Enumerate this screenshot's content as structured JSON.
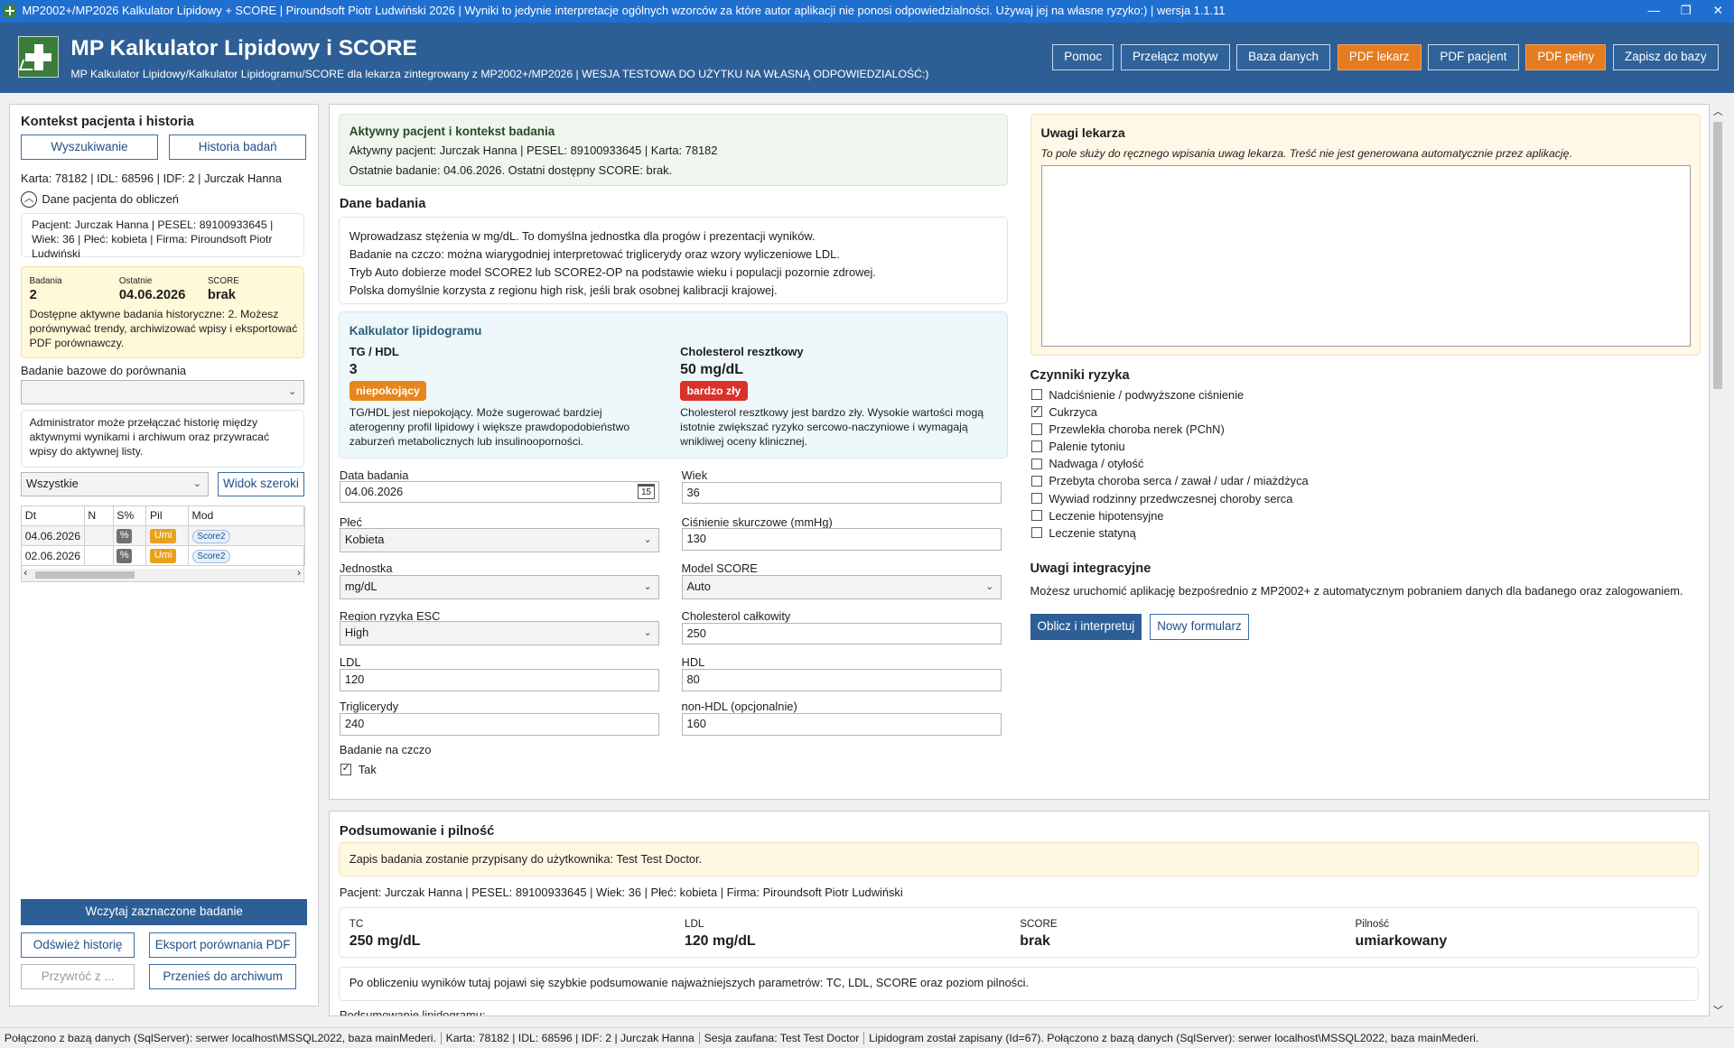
{
  "window": {
    "title": "MP2002+/MP2026 Kalkulator Lipidowy + SCORE | Piroundsoft Piotr Ludwiński 2026 | Wyniki to jedynie interpretacje ogólnych wzorców za które autor aplikacji nie ponosi odpowiedzialności. Używaj jej na własne ryzyko:) | wersja 1.1.11",
    "minimize": "—",
    "restore": "❐",
    "close": "✕"
  },
  "header": {
    "title": "MP Kalkulator Lipidowy i SCORE",
    "subtitle": "MP Kalkulator Lipidowy/Kalkulator Lipidogramu/SCORE dla lekarza zintegrowany z MP2002+/MP2026 | WESJA TESTOWA DO UŻYTKU NA WŁASNĄ ODPOWIEDZIALOŚĆ:)",
    "buttons": [
      "Pomoc",
      "Przełącz motyw",
      "Baza danych",
      "PDF lekarz",
      "PDF pacjent",
      "PDF pełny",
      "Zapisz do bazy"
    ]
  },
  "left": {
    "title": "Kontekst pacjenta i historia",
    "search_btn": "Wyszukiwanie",
    "history_btn": "Historia badań",
    "card_line": "Karta: 78182 | IDL: 68596 | IDF: 2 | Jurczak Hanna",
    "collapse_label": "Dane pacjenta do obliczeń",
    "patient_info": "Pacjent: Jurczak Hanna | PESEL: 89100933645 | Wiek: 36 | Płeć: kobieta | Firma: Piroundsoft  Piotr Ludwiński",
    "stats": {
      "badania_lbl": "Badania",
      "badania_val": "2",
      "ostatnie_lbl": "Ostatnie",
      "ostatnie_val": "04.06.2026",
      "score_lbl": "SCORE",
      "score_val": "brak",
      "desc": "Dostępne aktywne badania historyczne: 2. Możesz porównywać trendy, archiwizować wpisy i eksportować PDF porównawczy."
    },
    "baseline_label": "Badanie bazowe do porównania",
    "baseline_value": "",
    "admin_note": "Administrator może przełączać historię między aktywnymi wynikami i archiwum oraz przywracać wpisy do aktywnej listy.",
    "filter_value": "Wszystkie",
    "wide_view_btn": "Widok szeroki",
    "table": {
      "headers": [
        "Dt",
        "N",
        "S%",
        "Pil",
        "Mod"
      ],
      "rows": [
        {
          "dt": "04.06.2026",
          "n": "",
          "s": "%",
          "pil": "Umi",
          "mod": "Score2"
        },
        {
          "dt": "02.06.2026",
          "n": "",
          "s": "%",
          "pil": "Umi",
          "mod": "Score2"
        }
      ]
    },
    "load_btn": "Wczytaj zaznaczone badanie",
    "refresh_btn": "Odśwież historię",
    "export_btn": "Eksport porównania PDF",
    "restore_btn": "Przywróć z ...",
    "archive_btn": "Przenieś do archiwum"
  },
  "context": {
    "title": "Aktywny pacjent i kontekst badania",
    "line1": "Aktywny pacjent: Jurczak Hanna | PESEL: 89100933645 | Karta: 78182",
    "line2": "Ostatnie badanie: 04.06.2026. Ostatni dostępny SCORE: brak."
  },
  "dane": {
    "title": "Dane badania",
    "lines": [
      "Wprowadzasz stężenia w mg/dL. To domyślna jednostka dla progów i prezentacji wyników.",
      "Badanie na czczo: można wiarygodniej interpretować triglicerydy oraz wzory wyliczeniowe LDL.",
      "Tryb Auto dobierze model SCORE2 lub SCORE2-OP na podstawie wieku i populacji pozornie zdrowej.",
      "Polska domyślnie korzysta z regionu high risk, jeśli brak osobnej kalibracji krajowej."
    ]
  },
  "calc": {
    "title": "Kalkulator lipidogramu",
    "tg_label": "TG / HDL",
    "tg_value": "3",
    "tg_badge": "niepokojący",
    "tg_desc": "TG/HDL jest niepokojący. Może sugerować bardziej aterogenny profil lipidowy i większe prawdopodobieństwo zaburzeń metabolicznych lub insulinooporności.",
    "rc_label": "Cholesterol resztkowy",
    "rc_value": "50 mg/dL",
    "rc_badge": "bardzo zły",
    "rc_desc": "Cholesterol resztkowy jest bardzo zły. Wysokie wartości mogą istotnie zwiększać ryzyko sercowo-naczyniowe i wymagają wnikliwej oceny klinicznej.",
    "colors": {
      "warn": "#e8861e",
      "bad": "#d9312b"
    }
  },
  "form": {
    "date_lbl": "Data badania",
    "date_val": "04.06.2026",
    "age_lbl": "Wiek",
    "age_val": "36",
    "sex_lbl": "Płeć",
    "sex_val": "Kobieta",
    "bp_lbl": "Ciśnienie skurczowe (mmHg)",
    "bp_val": "130",
    "unit_lbl": "Jednostka",
    "unit_val": "mg/dL",
    "model_lbl": "Model SCORE",
    "model_val": "Auto",
    "region_lbl": "Region ryzyka ESC",
    "region_val": "High",
    "tc_lbl": "Cholesterol całkowity",
    "tc_val": "250",
    "ldl_lbl": "LDL",
    "ldl_val": "120",
    "hdl_lbl": "HDL",
    "hdl_val": "80",
    "tg_lbl": "Triglicerydy",
    "tg_val": "240",
    "nonhdl_lbl": "non-HDL (opcjonalnie)",
    "nonhdl_val": "160",
    "fasting_lbl": "Badanie na czczo",
    "fasting_opt": "Tak",
    "calendar_day": "15"
  },
  "notes": {
    "title": "Uwagi lekarza",
    "hint": "To pole służy do ręcznego wpisania uwag lekarza. Treść nie jest generowana automatycznie przez aplikację.",
    "text": ""
  },
  "risk": {
    "title": "Czynniki ryzyka",
    "items": [
      {
        "label": "Nadciśnienie / podwyższone ciśnienie",
        "checked": false
      },
      {
        "label": "Cukrzyca",
        "checked": true
      },
      {
        "label": "Przewlekła choroba nerek (PChN)",
        "checked": false
      },
      {
        "label": "Palenie tytoniu",
        "checked": false
      },
      {
        "label": "Nadwaga / otyłość",
        "checked": false
      },
      {
        "label": "Przebyta choroba serca / zawał / udar / miażdżyca",
        "checked": false
      },
      {
        "label": "Wywiad rodzinny przedwczesnej choroby serca",
        "checked": false
      },
      {
        "label": "Leczenie hipotensyjne",
        "checked": false
      },
      {
        "label": "Leczenie statyną",
        "checked": false
      }
    ]
  },
  "integration": {
    "title": "Uwagi integracyjne",
    "text": "Możesz uruchomić aplikację bezpośrednio z MP2002+ z automatycznym pobraniem danych dla badanego oraz zalogowaniem.",
    "calc_btn": "Oblicz i interpretuj",
    "new_btn": "Nowy formularz"
  },
  "summary": {
    "title": "Podsumowanie i pilność",
    "assign": "Zapis badania zostanie przypisany do użytkownika: Test Test Doctor.",
    "patient": "Pacjent: Jurczak Hanna | PESEL: 89100933645 | Wiek: 36 | Płeć: kobieta | Firma: Piroundsoft  Piotr Ludwiński",
    "kpis": [
      {
        "label": "TC",
        "value": "250 mg/dL"
      },
      {
        "label": "LDL",
        "value": "120 mg/dL"
      },
      {
        "label": "SCORE",
        "value": "brak"
      },
      {
        "label": "Pilność",
        "value": "umiarkowany"
      }
    ],
    "note": "Po obliczeniu wyników tutaj pojawi się szybkie podsumowanie najważniejszych parametrów: TC, LDL, SCORE oraz poziom pilności.",
    "cut": "Podsumowanie lipidogramu:"
  },
  "status": {
    "db": "Połączono z bazą danych (SqlServer): serwer localhost\\MSSQL2022, baza mainMederi.",
    "card": "Karta: 78182 | IDL: 68596 | IDF: 2 | Jurczak Hanna",
    "session": "Sesja zaufana: Test Test Doctor",
    "msg": "Lipidogram został zapisany (Id=67). Połączono z bazą danych (SqlServer): serwer localhost\\MSSQL2022, baza mainMederi."
  }
}
